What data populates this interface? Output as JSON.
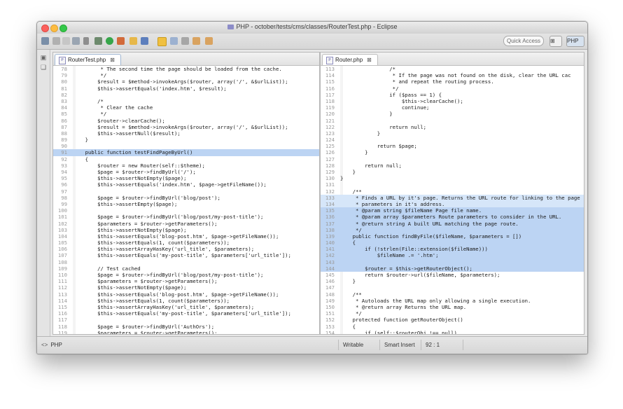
{
  "window": {
    "title": "PHP - october/tests/cms/classes/RouterTest.php - Eclipse"
  },
  "toolbar": {
    "quick_access_label": "Quick Access",
    "perspective_label": "PHP"
  },
  "left_editor": {
    "tab_label": "RouterTest.php",
    "selected_line": 91,
    "lines": [
      {
        "n": "78",
        "t": "         * The second time the page should be loaded from the cache."
      },
      {
        "n": "79",
        "t": "         */"
      },
      {
        "n": "80",
        "t": "        $result = $method->invokeArgs($router, array('/', &$urlList));"
      },
      {
        "n": "81",
        "t": "        $this->assertEquals('index.htm', $result);"
      },
      {
        "n": "82",
        "t": ""
      },
      {
        "n": "83",
        "t": "        /*"
      },
      {
        "n": "84",
        "t": "         * Clear the cache"
      },
      {
        "n": "85",
        "t": "         */"
      },
      {
        "n": "86",
        "t": "        $router->clearCache();"
      },
      {
        "n": "87",
        "t": "        $result = $method->invokeArgs($router, array('/', &$urlList));"
      },
      {
        "n": "88",
        "t": "        $this->assertNull($result);"
      },
      {
        "n": "89",
        "t": "    }"
      },
      {
        "n": "90",
        "t": ""
      },
      {
        "n": "91",
        "t": "    public function testFindPageByUrl()"
      },
      {
        "n": "92",
        "t": "    {"
      },
      {
        "n": "93",
        "t": "        $router = new Router(self::$theme);"
      },
      {
        "n": "94",
        "t": "        $page = $router->findByUrl('/');"
      },
      {
        "n": "95",
        "t": "        $this->assertNotEmpty($page);"
      },
      {
        "n": "96",
        "t": "        $this->assertEquals('index.htm', $page->getFileName());"
      },
      {
        "n": "97",
        "t": ""
      },
      {
        "n": "98",
        "t": "        $page = $router->findByUrl('blog/post');"
      },
      {
        "n": "99",
        "t": "        $this->assertEmpty($page);"
      },
      {
        "n": "100",
        "t": ""
      },
      {
        "n": "101",
        "t": "        $page = $router->findByUrl('blog/post/my-post-title');"
      },
      {
        "n": "102",
        "t": "        $parameters = $router->getParameters();"
      },
      {
        "n": "103",
        "t": "        $this->assertNotEmpty($page);"
      },
      {
        "n": "104",
        "t": "        $this->assertEquals('blog-post.htm', $page->getFileName());"
      },
      {
        "n": "105",
        "t": "        $this->assertEquals(1, count($parameters));"
      },
      {
        "n": "106",
        "t": "        $this->assertArrayHasKey('url_title', $parameters);"
      },
      {
        "n": "107",
        "t": "        $this->assertEquals('my-post-title', $parameters['url_title']);"
      },
      {
        "n": "108",
        "t": ""
      },
      {
        "n": "109",
        "t": "        // Test cached"
      },
      {
        "n": "110",
        "t": "        $page = $router->findByUrl('blog/post/my-post-title');"
      },
      {
        "n": "111",
        "t": "        $parameters = $router->getParameters();"
      },
      {
        "n": "112",
        "t": "        $this->assertNotEmpty($page);"
      },
      {
        "n": "113",
        "t": "        $this->assertEquals('blog-post.htm', $page->getFileName());"
      },
      {
        "n": "114",
        "t": "        $this->assertEquals(1, count($parameters));"
      },
      {
        "n": "115",
        "t": "        $this->assertArrayHasKey('url_title', $parameters);"
      },
      {
        "n": "116",
        "t": "        $this->assertEquals('my-post-title', $parameters['url_title']);"
      },
      {
        "n": "117",
        "t": ""
      },
      {
        "n": "118",
        "t": "        $page = $router->findByUrl('AuthOrs');"
      },
      {
        "n": "119",
        "t": "        $parameters = $router->getParameters();"
      },
      {
        "n": "120",
        "t": "        $this->assertNotEmpty($page);"
      }
    ]
  },
  "right_editor": {
    "tab_label": "Router.php",
    "lines": [
      {
        "n": "113",
        "t": "                /*"
      },
      {
        "n": "114",
        "t": "                 * If the page was not found on the disk, clear the URL cac"
      },
      {
        "n": "115",
        "t": "                 * and repeat the routing process."
      },
      {
        "n": "116",
        "t": "                 */"
      },
      {
        "n": "117",
        "t": "                if ($pass == 1) {"
      },
      {
        "n": "118",
        "t": "                    $this->clearCache();"
      },
      {
        "n": "119",
        "t": "                    continue;"
      },
      {
        "n": "120",
        "t": "                }"
      },
      {
        "n": "121",
        "t": ""
      },
      {
        "n": "122",
        "t": "                return null;"
      },
      {
        "n": "123",
        "t": "            }"
      },
      {
        "n": "124",
        "t": ""
      },
      {
        "n": "125",
        "t": "            return $page;"
      },
      {
        "n": "126",
        "t": "        }"
      },
      {
        "n": "127",
        "t": ""
      },
      {
        "n": "128",
        "t": "        return null;"
      },
      {
        "n": "129",
        "t": "    }"
      },
      {
        "n": "130",
        "t": "}"
      },
      {
        "n": "131",
        "t": ""
      },
      {
        "n": "132",
        "t": "    /**"
      },
      {
        "n": "133",
        "t": "     * Finds a URL by it's page. Returns the URL route for linking to the page"
      },
      {
        "n": "134",
        "t": "     * parameters in it's address."
      },
      {
        "n": "135",
        "t": "     * @param string $fileName Page file name."
      },
      {
        "n": "136",
        "t": "     * @param array $parameters Route parameters to consider in the URL."
      },
      {
        "n": "137",
        "t": "     * @return string A built URL matching the page route."
      },
      {
        "n": "138",
        "t": "     */"
      },
      {
        "n": "139",
        "t": "    public function findByFile($fileName, $parameters = [])"
      },
      {
        "n": "140",
        "t": "    {"
      },
      {
        "n": "141",
        "t": "        if (!strlen(File::extension($fileName)))"
      },
      {
        "n": "142",
        "t": "            $fileName .= '.htm';"
      },
      {
        "n": "143",
        "t": ""
      },
      {
        "n": "144",
        "t": "        $router = $this->getRouterObject();"
      },
      {
        "n": "145",
        "t": "        return $router->url($fileName, $parameters);"
      },
      {
        "n": "146",
        "t": "    }"
      },
      {
        "n": "147",
        "t": ""
      },
      {
        "n": "148",
        "t": "    /**"
      },
      {
        "n": "149",
        "t": "     * Autoloads the URL map only allowing a single execution."
      },
      {
        "n": "150",
        "t": "     * @return array Returns the URL map."
      },
      {
        "n": "151",
        "t": "     */"
      },
      {
        "n": "152",
        "t": "    protected function getRouterObject()"
      },
      {
        "n": "153",
        "t": "    {"
      },
      {
        "n": "154",
        "t": "        if (self::$routerObj !== null)"
      },
      {
        "n": "155",
        "t": "            return self::$routerObj;"
      }
    ]
  },
  "status": {
    "language": "PHP",
    "write_mode": "Writable",
    "insert_mode": "Smart Insert",
    "cursor_position": "92 : 1"
  }
}
